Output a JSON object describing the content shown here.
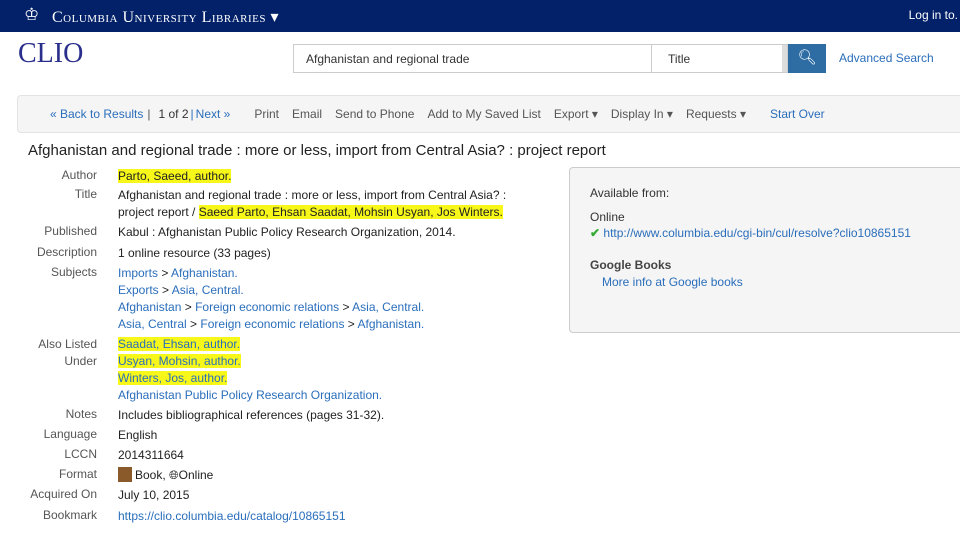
{
  "header": {
    "brand": "Columbia University Libraries",
    "brand_caret": "▾",
    "login": "Log in to."
  },
  "logo": "CLIO",
  "search": {
    "value": "Afghanistan and regional trade",
    "field": "Title",
    "button_icon": "search-icon",
    "advanced": "Advanced Search"
  },
  "toolbar": {
    "back": "« Back to Results",
    "sep": "|",
    "position": "1 of 2",
    "next": "Next »",
    "items": [
      "Print",
      "Email",
      "Send to Phone",
      "Add to My Saved List",
      "Export ▾",
      "Display In ▾",
      "Requests ▾"
    ],
    "start_over": "Start Over"
  },
  "record": {
    "title": "Afghanistan and regional trade : more or less, import from Central Asia? : project report",
    "labels": {
      "author": "Author",
      "title": "Title",
      "published": "Published",
      "description": "Description",
      "subjects": "Subjects",
      "also1": "Also Listed",
      "also2": "Under",
      "notes": "Notes",
      "language": "Language",
      "lccn": "LCCN",
      "format": "Format",
      "acquired": "Acquired On",
      "bookmark": "Bookmark"
    },
    "author": "Parto, Saeed, author.",
    "title_main": "Afghanistan and regional trade : more or less, import from Central Asia? : project report /",
    "title_resp": "Saeed Parto, Ehsan Saadat, Mohsin Usyan, Jos Winters.",
    "published": "Kabul : Afghanistan Public Policy Research Organization, 2014.",
    "description": "1 online resource (33 pages)",
    "subjects": [
      [
        "Imports",
        "Afghanistan."
      ],
      [
        "Exports",
        "Asia, Central."
      ],
      [
        "Afghanistan",
        "Foreign economic relations",
        "Asia, Central."
      ],
      [
        "Asia, Central",
        "Foreign economic relations",
        "Afghanistan."
      ]
    ],
    "also_listed": [
      "Saadat, Ehsan, author.",
      "Usyan, Mohsin, author.",
      "Winters, Jos, author.",
      "Afghanistan Public Policy Research Organization."
    ],
    "notes": "Includes bibliographical references (pages 31-32).",
    "language": "English",
    "lccn": "2014311664",
    "format_book": "Book,",
    "format_online": "Online",
    "acquired": "July 10, 2015",
    "bookmark": "https://clio.columbia.edu/catalog/10865151"
  },
  "availability": {
    "heading": "Available from:",
    "online": "Online",
    "url": "http://www.columbia.edu/cgi-bin/cul/resolve?clio10865151",
    "google_heading": "Google Books",
    "google_link": "More info at Google books"
  }
}
